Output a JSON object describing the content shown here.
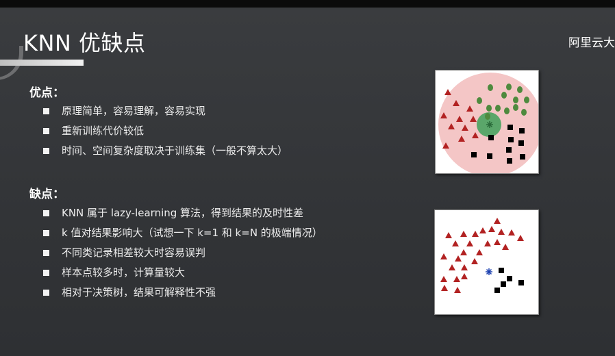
{
  "slide": {
    "title": "KNN 优缺点",
    "brand": "阿里云大"
  },
  "advantages": {
    "heading": "优点：",
    "items": [
      "原理简单，容易理解，容易实现",
      "重新训练代价较低",
      "时间、空间复杂度取决于训练集（一般不算太大）"
    ]
  },
  "disadvantages": {
    "heading": "缺点：",
    "items": [
      "KNN 属于 lazy-learning 算法，得到结果的及时性差",
      "k 值对结果影响大（试想一下 k=1 和 k=N 的极端情况）",
      "不同类记录相差较大时容易误判",
      "样本点较多时，计算量较大",
      "相对于决策树，结果可解释性不强"
    ]
  },
  "colors": {
    "background": "#343638",
    "triangle": "#b22222",
    "square": "#000000",
    "green_dot": "#4e8a3e",
    "neighborhood_circle": "#f4c6c6",
    "query_circle": "#5aa66a",
    "query_star": "#1a3fb0"
  },
  "icons": {
    "bullet": "square-bullet-icon",
    "query_point": "star-icon"
  }
}
